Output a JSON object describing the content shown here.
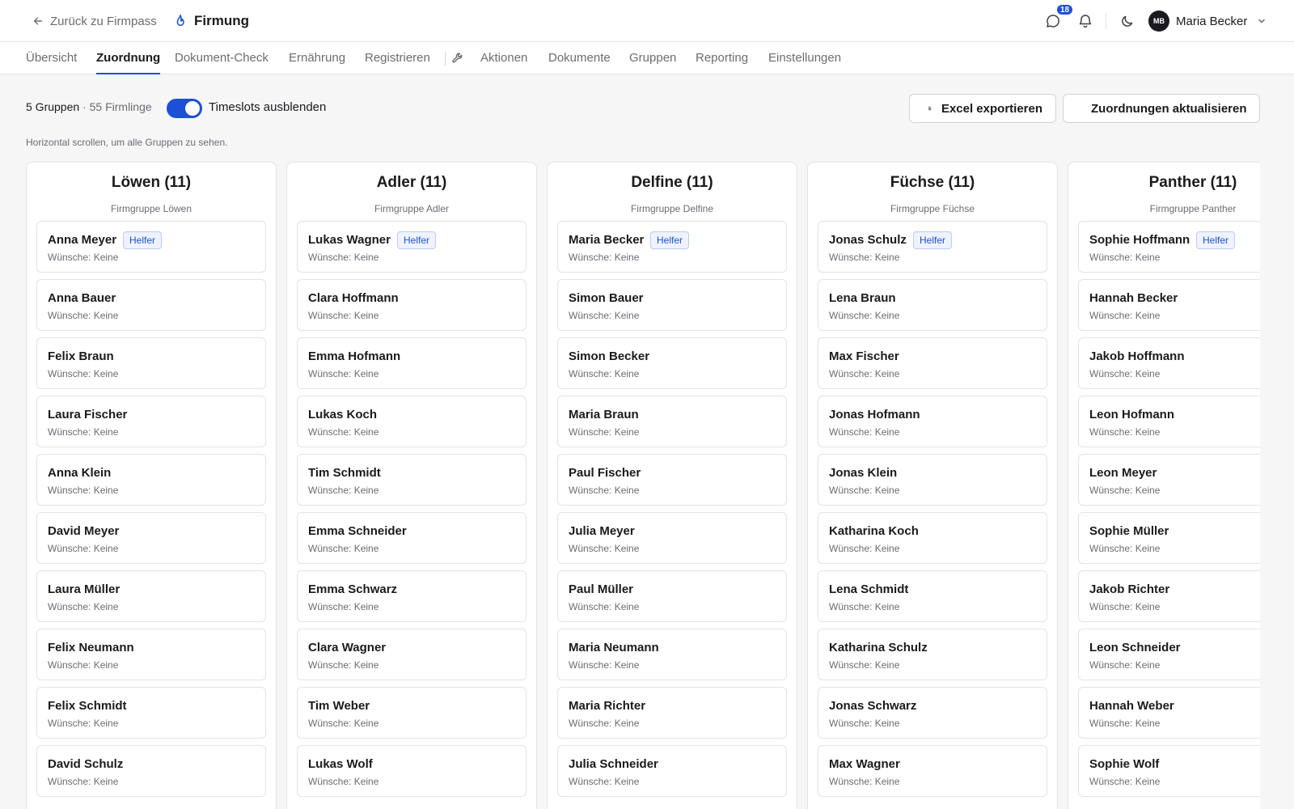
{
  "header": {
    "back_label": "Zurück zu Firmpass",
    "brand": "Firmung",
    "messages_badge": "18",
    "user": {
      "initials": "MB",
      "name": "Maria Becker"
    }
  },
  "tabs": [
    {
      "label": "Übersicht"
    },
    {
      "label": "Zuordnung",
      "active": true
    },
    {
      "label": "Dokument-Check"
    },
    {
      "label": "Ernährung"
    },
    {
      "label": "Registrieren"
    },
    {
      "label": "Aktionen"
    },
    {
      "label": "Dokumente"
    },
    {
      "label": "Gruppen"
    },
    {
      "label": "Reporting"
    },
    {
      "label": "Einstellungen"
    }
  ],
  "toolbar": {
    "groups_count": "5 Gruppen",
    "participants_count": "· 55 Firmlinge",
    "toggle_on": true,
    "toggle_label": "Timeslots ausblenden",
    "export_label": "Excel exportieren",
    "refresh_label": "Zuordnungen aktualisieren",
    "hint": "Horizontal scrollen, um alle Gruppen zu sehen."
  },
  "labels": {
    "helper": "Helfer",
    "wishes": "Wünsche: Keine"
  },
  "colors": {
    "accent": "#1d4fd8",
    "helper_bg": "#eef3ff"
  },
  "groups": [
    {
      "title": "Löwen (11)",
      "subtitle": "Firmgruppe Löwen",
      "members": [
        "Anna Meyer",
        "Anna Bauer",
        "Felix Braun",
        "Laura Fischer",
        "Anna Klein",
        "David Meyer",
        "Laura Müller",
        "Felix Neumann",
        "Felix Schmidt",
        "David Schulz"
      ]
    },
    {
      "title": "Adler (11)",
      "subtitle": "Firmgruppe Adler",
      "members": [
        "Lukas Wagner",
        "Clara Hoffmann",
        "Emma Hofmann",
        "Lukas Koch",
        "Tim Schmidt",
        "Emma Schneider",
        "Emma Schwarz",
        "Clara Wagner",
        "Tim Weber",
        "Lukas Wolf"
      ]
    },
    {
      "title": "Delfine (11)",
      "subtitle": "Firmgruppe Delfine",
      "members": [
        "Maria Becker",
        "Simon Bauer",
        "Simon Becker",
        "Maria Braun",
        "Paul Fischer",
        "Julia Meyer",
        "Paul Müller",
        "Maria Neumann",
        "Maria Richter",
        "Julia Schneider"
      ]
    },
    {
      "title": "Füchse (11)",
      "subtitle": "Firmgruppe Füchse",
      "members": [
        "Jonas Schulz",
        "Lena Braun",
        "Max Fischer",
        "Jonas Hofmann",
        "Jonas Klein",
        "Katharina Koch",
        "Lena Schmidt",
        "Katharina Schulz",
        "Jonas Schwarz",
        "Max Wagner"
      ]
    },
    {
      "title": "Panther (11)",
      "subtitle": "Firmgruppe Panther",
      "members": [
        "Sophie Hoffmann",
        "Hannah Becker",
        "Jakob Hoffmann",
        "Leon Hofmann",
        "Leon Meyer",
        "Sophie Müller",
        "Jakob Richter",
        "Leon Schneider",
        "Hannah Weber",
        "Sophie Wolf"
      ]
    }
  ]
}
